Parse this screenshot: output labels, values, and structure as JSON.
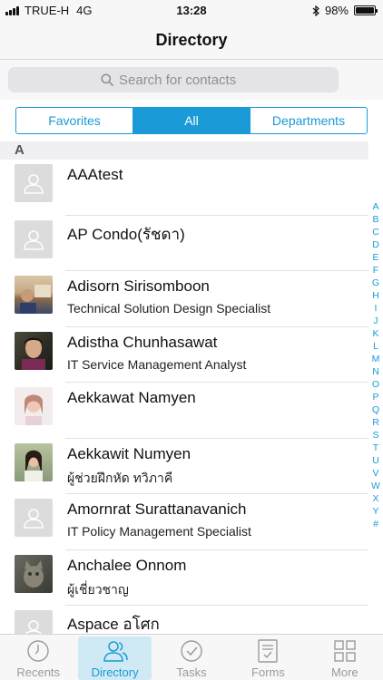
{
  "status_bar": {
    "carrier": "TRUE-H",
    "network": "4G",
    "time": "13:28",
    "battery_percent": "98%",
    "battery_level": 0.98
  },
  "nav": {
    "title": "Directory"
  },
  "search": {
    "placeholder": "Search for contacts"
  },
  "segments": [
    "Favorites",
    "All",
    "Departments"
  ],
  "active_segment": "All",
  "section": "A",
  "contacts": [
    {
      "name": "AAAtest",
      "title": "",
      "avatar": "placeholder"
    },
    {
      "name": "AP Condo(รัชดา)",
      "title": "",
      "avatar": "placeholder"
    },
    {
      "name": "Adisorn Sirisomboon",
      "title": "Technical Solution Design Specialist",
      "avatar": "photo"
    },
    {
      "name": "Adistha Chunhasawat",
      "title": "IT Service Management Analyst",
      "avatar": "photo"
    },
    {
      "name": "Aekkawat Namyen",
      "title": "",
      "avatar": "photo"
    },
    {
      "name": "Aekkawit Numyen",
      "title": "ผู้ช่วยฝึกหัด ทวิภาคี",
      "avatar": "photo"
    },
    {
      "name": "Amornrat Surattanavanich",
      "title": "IT Policy Management Specialist",
      "avatar": "placeholder"
    },
    {
      "name": "Anchalee Onnom",
      "title": "ผู้เชี่ยวชาญ",
      "avatar": "photo"
    },
    {
      "name": "Aspace อโศก",
      "title": "",
      "avatar": "placeholder"
    }
  ],
  "index_letters": [
    "A",
    "B",
    "C",
    "D",
    "E",
    "F",
    "G",
    "H",
    "I",
    "J",
    "K",
    "L",
    "M",
    "N",
    "O",
    "P",
    "Q",
    "R",
    "S",
    "T",
    "U",
    "V",
    "W",
    "X",
    "Y",
    "#"
  ],
  "tabs": [
    {
      "label": "Recents",
      "icon": "clock-icon"
    },
    {
      "label": "Directory",
      "icon": "people-icon"
    },
    {
      "label": "Tasks",
      "icon": "check-circle-icon"
    },
    {
      "label": "Forms",
      "icon": "form-icon"
    },
    {
      "label": "More",
      "icon": "grid-icon"
    }
  ],
  "active_tab": "Directory",
  "colors": {
    "accent": "#1a9ad6",
    "accent_light": "#cfe9f5",
    "inactive": "#9a9a9a"
  }
}
